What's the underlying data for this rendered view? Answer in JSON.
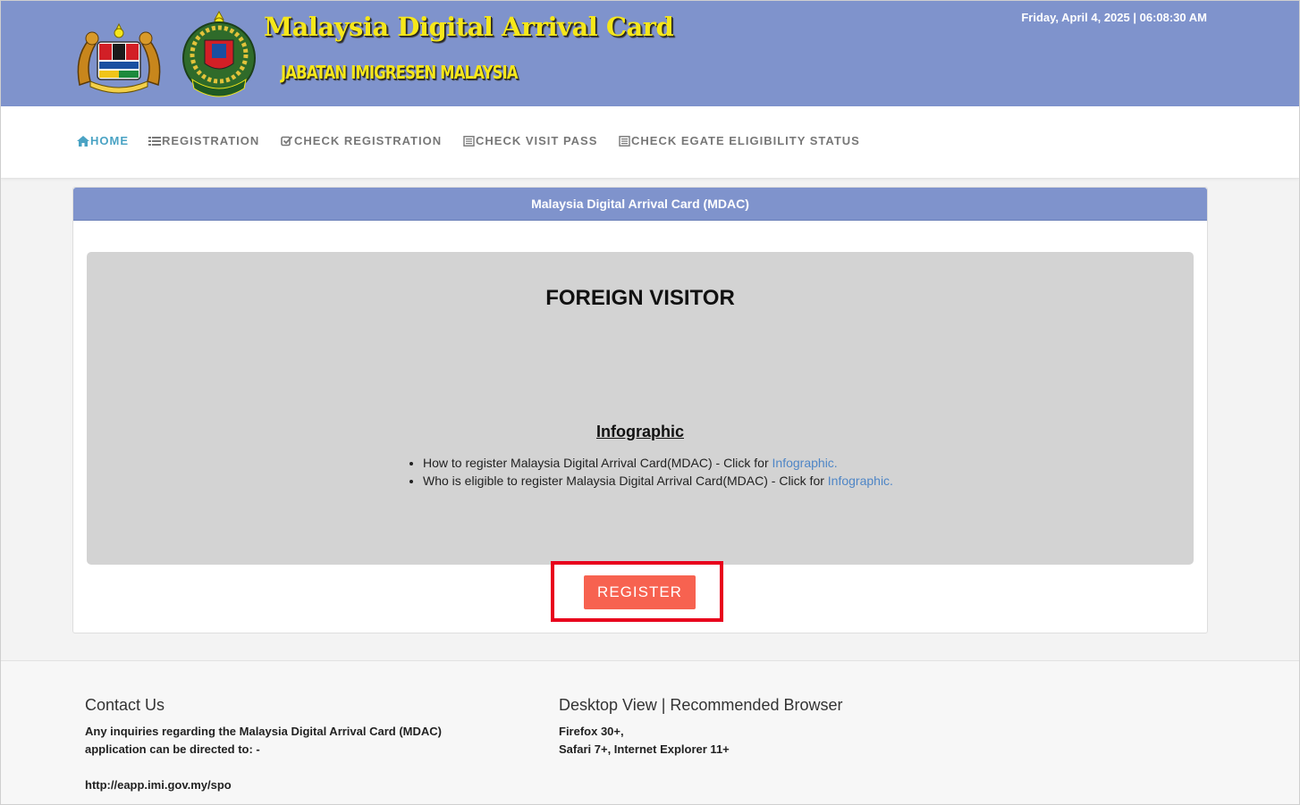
{
  "header": {
    "title": "Malaysia Digital Arrival Card",
    "subtitle": "JABATAN IMIGRESEN MALAYSIA",
    "datetime": "Friday, April 4, 2025 | 06:08:30 AM",
    "colors": {
      "banner": "#7f93cc",
      "title": "#f6e71a"
    }
  },
  "nav": {
    "items": [
      {
        "label": "HOME",
        "icon": "home-icon",
        "active": true
      },
      {
        "label": "REGISTRATION",
        "icon": "list-icon"
      },
      {
        "label": "CHECK REGISTRATION",
        "icon": "check-square-icon"
      },
      {
        "label": "CHECK VISIT PASS",
        "icon": "document-icon"
      },
      {
        "label": "CHECK EGATE ELIGIBILITY STATUS",
        "icon": "document-icon"
      }
    ]
  },
  "panel": {
    "heading": "Malaysia Digital Arrival Card (MDAC)",
    "section_title": "FOREIGN VISITOR",
    "infographic_title": "Infographic",
    "items": [
      {
        "text": "How to register Malaysia Digital Arrival Card(MDAC) - Click for ",
        "link": "Infographic."
      },
      {
        "text": "Who is eligible to register Malaysia Digital Arrival Card(MDAC) - Click for ",
        "link": "Infographic."
      }
    ],
    "register_label": "REGISTER",
    "colors": {
      "register": "#f76250",
      "highlight": "#e8001c"
    }
  },
  "footer": {
    "contact": {
      "heading": "Contact Us",
      "line1": "Any inquiries regarding the Malaysia Digital Arrival Card (MDAC)",
      "line2": "application can be directed to: -",
      "url": "http://eapp.imi.gov.my/spo"
    },
    "browser": {
      "heading": "Desktop View | Recommended Browser",
      "line1": "Firefox 30+,",
      "line2": "Safari 7+, Internet Explorer 11+"
    }
  }
}
